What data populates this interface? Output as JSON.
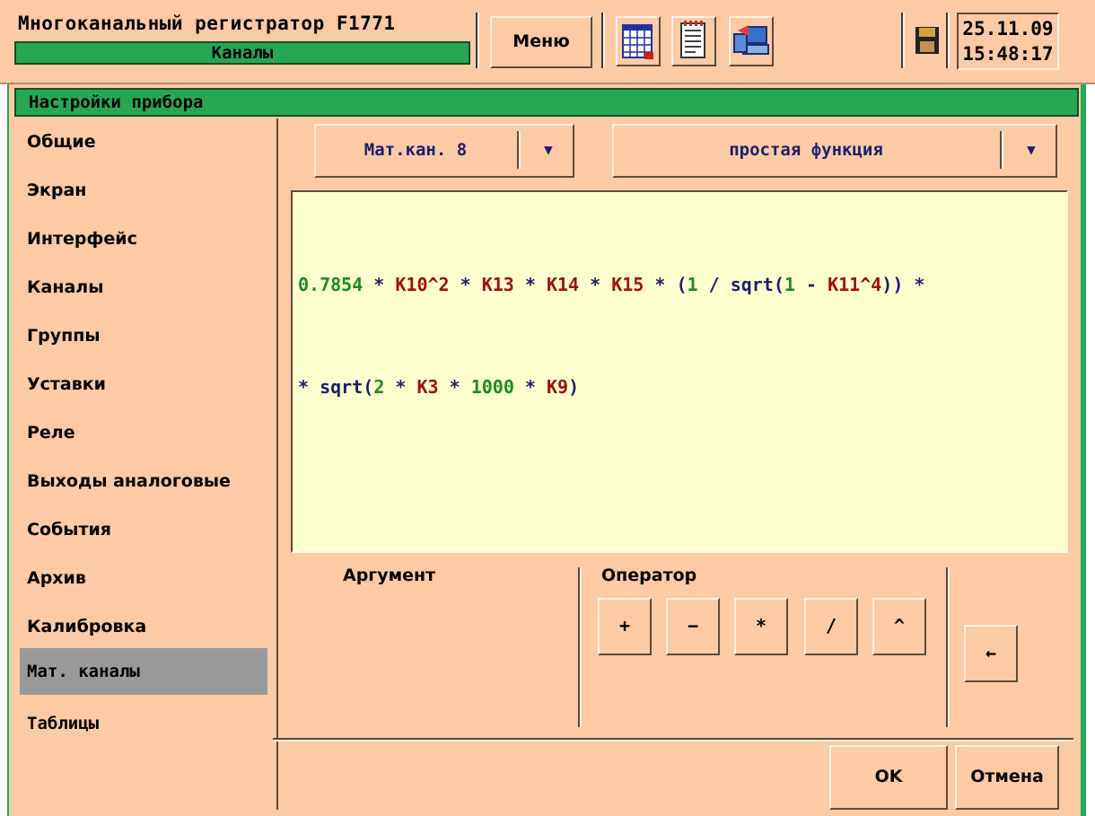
{
  "header": {
    "app_title": "Многоканальный регистратор F1771",
    "mode": "Каналы",
    "menu_label": "Меню",
    "date": "25.11.09",
    "time": "15:48:17"
  },
  "panel": {
    "title": "Настройки прибора"
  },
  "sidebar": {
    "items": [
      {
        "label": "Общие"
      },
      {
        "label": "Экран"
      },
      {
        "label": "Интерфейс"
      },
      {
        "label": "Каналы"
      },
      {
        "label": "Группы"
      },
      {
        "label": "Уставки"
      },
      {
        "label": "Реле"
      },
      {
        "label": "Выходы аналоговые"
      },
      {
        "label": "События"
      },
      {
        "label": "Архив"
      },
      {
        "label": "Калибровка"
      },
      {
        "label": "Мат. каналы"
      },
      {
        "label": "Таблицы"
      }
    ],
    "active_index": 11
  },
  "channel_select": {
    "value": "Мат.кан. 8",
    "arrow": "▼"
  },
  "function_select": {
    "value": "простая функция",
    "arrow": "▼"
  },
  "formula": {
    "line1": [
      {
        "t": "0.7854",
        "k": "num"
      },
      {
        "t": " * ",
        "k": "op"
      },
      {
        "t": "K10^2",
        "k": "ch"
      },
      {
        "t": " * ",
        "k": "op"
      },
      {
        "t": "K13",
        "k": "ch"
      },
      {
        "t": " * ",
        "k": "op"
      },
      {
        "t": "K14",
        "k": "ch"
      },
      {
        "t": " * ",
        "k": "op"
      },
      {
        "t": "K15",
        "k": "ch"
      },
      {
        "t": " * (",
        "k": "op"
      },
      {
        "t": "1",
        "k": "num"
      },
      {
        "t": " / ",
        "k": "op"
      },
      {
        "t": "sqrt",
        "k": "fn"
      },
      {
        "t": "(",
        "k": "op"
      },
      {
        "t": "1",
        "k": "num"
      },
      {
        "t": " - ",
        "k": "op"
      },
      {
        "t": "K11^4",
        "k": "ch"
      },
      {
        "t": ")) *",
        "k": "op"
      }
    ],
    "line2": [
      {
        "t": "* ",
        "k": "op"
      },
      {
        "t": "sqrt",
        "k": "fn"
      },
      {
        "t": "(",
        "k": "op"
      },
      {
        "t": "2",
        "k": "num"
      },
      {
        "t": " * ",
        "k": "op"
      },
      {
        "t": "K3",
        "k": "ch"
      },
      {
        "t": " * ",
        "k": "op"
      },
      {
        "t": "1000",
        "k": "num"
      },
      {
        "t": " * ",
        "k": "op"
      },
      {
        "t": "K9",
        "k": "ch"
      },
      {
        "t": ")",
        "k": "op"
      }
    ]
  },
  "argument_label": "Аргумент",
  "operator_label": "Оператор",
  "operators": [
    "+",
    "−",
    "*",
    "/",
    "^"
  ],
  "backspace_label": "←",
  "buttons": {
    "ok": "OK",
    "cancel": "Отмена"
  },
  "colors": {
    "background": "#fccaa5",
    "accent_green": "#25a851",
    "formula_bg": "#feffcf",
    "number": "#1c8c1c",
    "channel": "#a01010",
    "function": "#1b1f6e"
  }
}
